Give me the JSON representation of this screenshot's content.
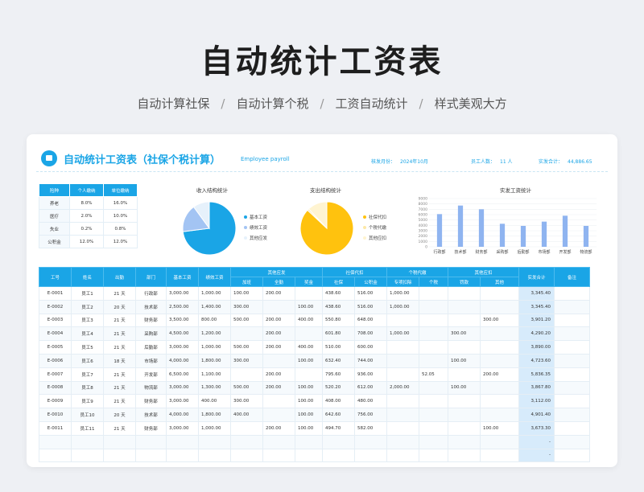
{
  "hero": {
    "title": "自动统计工资表",
    "features": [
      "自动计算社保",
      "自动计算个税",
      "工资自动统计",
      "样式美观大方"
    ],
    "separator": "/"
  },
  "sheet": {
    "title": "自动统计工资表（社保个税计算）",
    "subtitle_en": "Employee payroll",
    "period_label": "核发月份：",
    "period_value": "2024年10月",
    "headcount_label": "员工人数：",
    "headcount_value": "11 人",
    "total_label": "实发合计：",
    "total_value": "44,886.65"
  },
  "rates": {
    "headers": [
      "险种",
      "个人缴纳",
      "单位缴纳"
    ],
    "rows": [
      [
        "养老",
        "8.0%",
        "16.0%"
      ],
      [
        "医疗",
        "2.0%",
        "10.0%"
      ],
      [
        "失业",
        "0.2%",
        "0.8%"
      ],
      [
        "公积金",
        "12.0%",
        "12.0%"
      ]
    ]
  },
  "charts": {
    "colors": {
      "blue": "#1aa5e6",
      "lightblue": "#a3c4f3",
      "pale": "#e6f1fb",
      "yellow": "#ffc20e",
      "paleyellow": "#fde9a8",
      "bar": "#8fb4f0"
    },
    "income": {
      "title": "收入结构统计",
      "legend": [
        "基本工资",
        "绩效工资",
        "其他应发"
      ],
      "values": [
        73,
        17,
        10
      ]
    },
    "expense": {
      "title": "支出结构统计",
      "legend": [
        "社保代扣",
        "个税代缴",
        "其他应扣"
      ],
      "values": [
        87,
        1,
        12
      ]
    }
  },
  "chart_data": {
    "type": "bar",
    "title": "实发工资统计",
    "categories": [
      "行政部",
      "技术部",
      "财务部",
      "采购部",
      "后勤部",
      "市场部",
      "开发部",
      "物流部"
    ],
    "values": [
      6100,
      7700,
      7000,
      4300,
      3900,
      4700,
      5800,
      3900
    ],
    "ylim": [
      0,
      9000
    ],
    "yticks": [
      "0",
      "1000",
      "2000",
      "3000",
      "4000",
      "5000",
      "6000",
      "7000",
      "8000",
      "9000"
    ]
  },
  "table": {
    "group_headers": {
      "other_income": "其他应发",
      "social": "社保代扣",
      "tax": "个税代缴",
      "other_deduct": "其他应扣"
    },
    "columns": [
      "工号",
      "姓名",
      "出勤",
      "部门",
      "基本工资",
      "绩效工资",
      "加班",
      "全勤",
      "奖金",
      "社保",
      "公积金",
      "专项扣除",
      "个税",
      "罚款",
      "其他",
      "实发合计",
      "备注"
    ],
    "rows": [
      [
        "E-0001",
        "员工1",
        "21 天",
        "行政部",
        "3,000.00",
        "1,000.00",
        "100.00",
        "200.00",
        "",
        "438.60",
        "516.00",
        "1,000.00",
        "",
        "",
        "",
        "3,345.40",
        ""
      ],
      [
        "E-0002",
        "员工2",
        "20 天",
        "技术部",
        "2,500.00",
        "1,400.00",
        "300.00",
        "",
        "100.00",
        "438.60",
        "516.00",
        "1,000.00",
        "",
        "",
        "",
        "3,345.40",
        ""
      ],
      [
        "E-0003",
        "员工3",
        "21 天",
        "财务部",
        "3,500.00",
        "800.00",
        "500.00",
        "200.00",
        "400.00",
        "550.80",
        "648.00",
        "",
        "",
        "",
        "300.00",
        "3,901.20",
        ""
      ],
      [
        "E-0004",
        "员工4",
        "21 天",
        "采购部",
        "4,500.00",
        "1,200.00",
        "",
        "200.00",
        "",
        "601.80",
        "708.00",
        "1,000.00",
        "",
        "300.00",
        "",
        "4,290.20",
        ""
      ],
      [
        "E-0005",
        "员工5",
        "21 天",
        "后勤部",
        "3,000.00",
        "1,000.00",
        "500.00",
        "200.00",
        "400.00",
        "510.00",
        "600.00",
        "",
        "",
        "",
        "",
        "3,890.00",
        ""
      ],
      [
        "E-0006",
        "员工6",
        "18 天",
        "市场部",
        "4,000.00",
        "1,800.00",
        "300.00",
        "",
        "100.00",
        "632.40",
        "744.00",
        "",
        "",
        "100.00",
        "",
        "4,723.60",
        ""
      ],
      [
        "E-0007",
        "员工7",
        "21 天",
        "开发部",
        "6,500.00",
        "1,100.00",
        "",
        "200.00",
        "",
        "795.60",
        "936.00",
        "",
        "52.05",
        "",
        "200.00",
        "5,836.35",
        ""
      ],
      [
        "E-0008",
        "员工8",
        "21 天",
        "物流部",
        "3,000.00",
        "1,300.00",
        "500.00",
        "200.00",
        "100.00",
        "520.20",
        "612.00",
        "2,000.00",
        "",
        "100.00",
        "",
        "3,867.80",
        ""
      ],
      [
        "E-0009",
        "员工9",
        "21 天",
        "财务部",
        "3,000.00",
        "400.00",
        "300.00",
        "",
        "100.00",
        "408.00",
        "480.00",
        "",
        "",
        "",
        "",
        "3,112.00",
        ""
      ],
      [
        "E-0010",
        "员工10",
        "20 天",
        "技术部",
        "4,000.00",
        "1,800.00",
        "400.00",
        "",
        "100.00",
        "642.60",
        "756.00",
        "",
        "",
        "",
        "",
        "4,901.40",
        ""
      ],
      [
        "E-0011",
        "员工11",
        "21 天",
        "财务部",
        "3,000.00",
        "1,000.00",
        "",
        "200.00",
        "100.00",
        "494.70",
        "582.00",
        "",
        "",
        "",
        "100.00",
        "3,673.30",
        ""
      ],
      [
        "",
        "",
        "",
        "",
        "",
        "",
        "",
        "",
        "",
        "",
        "",
        "",
        "",
        "",
        "",
        "-",
        ""
      ],
      [
        "",
        "",
        "",
        "",
        "",
        "",
        "",
        "",
        "",
        "",
        "",
        "",
        "",
        "",
        "",
        "-",
        ""
      ]
    ]
  }
}
